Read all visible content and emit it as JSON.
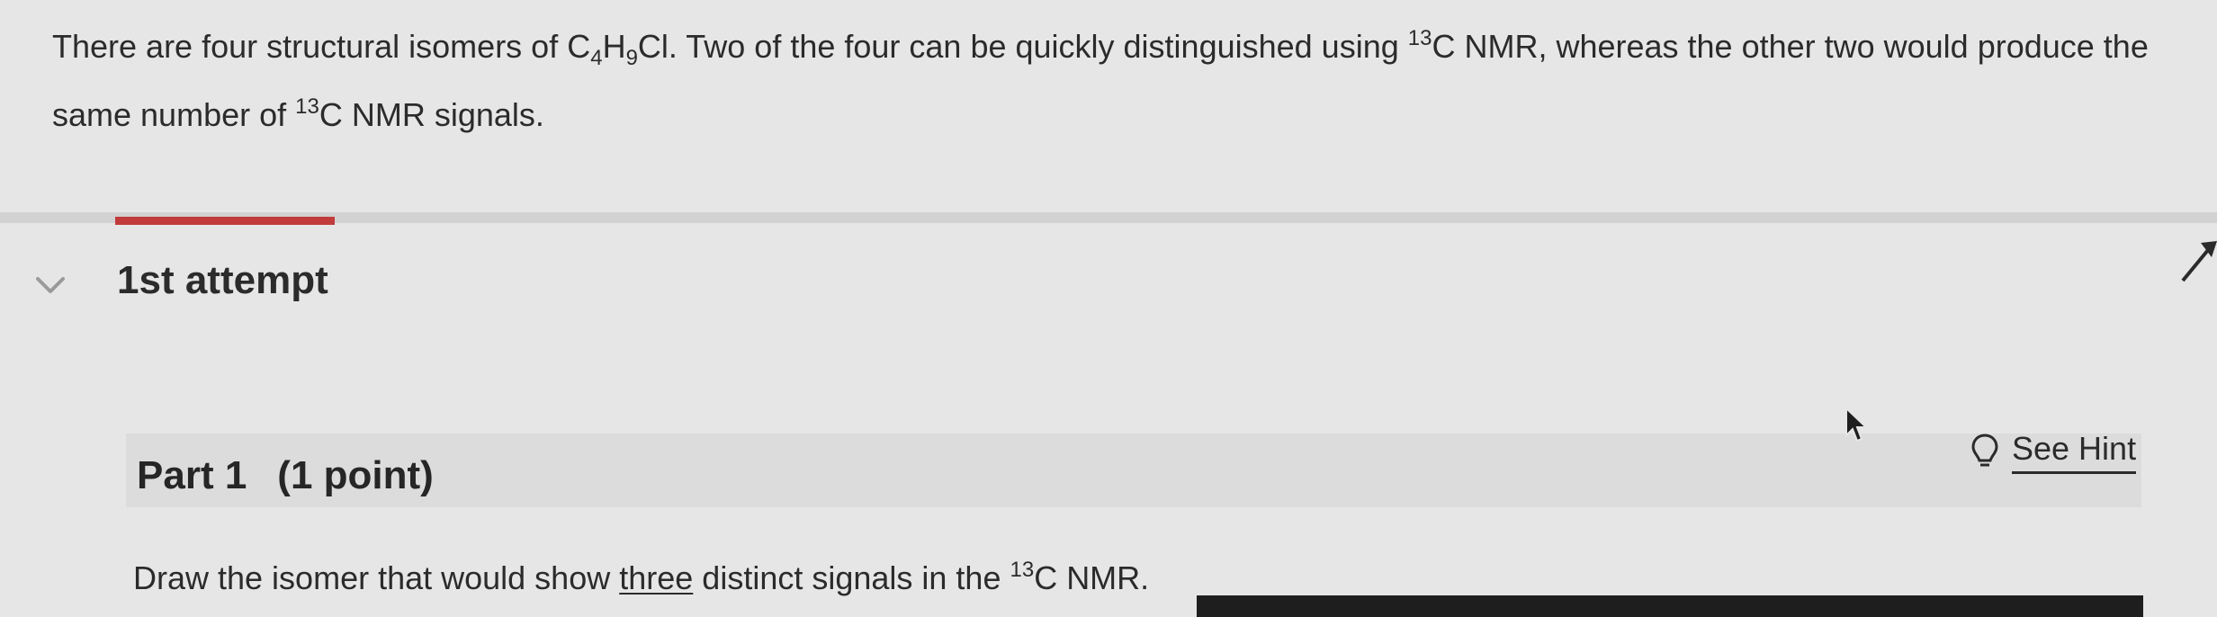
{
  "question": {
    "t1": "There are four structural isomers of C",
    "sub1": "4",
    "t2": "H",
    "sub2": "9",
    "t3": "Cl. Two of the four can be quickly distinguished using ",
    "sup1": "13",
    "t4": "C NMR, whereas the other two would produce the same number of ",
    "sup2": "13",
    "t5": "C NMR signals."
  },
  "attempt": {
    "label": "1st attempt"
  },
  "part": {
    "title": "Part 1",
    "points": "(1 point)"
  },
  "hint": {
    "label": "See Hint",
    "icon": "lightbulb-icon"
  },
  "prompt": {
    "t1": "Draw the isomer that would show ",
    "emphasis": "three",
    "t2": " distinct signals in the ",
    "sup": "13",
    "t3": "C NMR."
  },
  "colors": {
    "background": "#e6e6e6",
    "progress": "#c23b3b",
    "text": "#2b2b2b"
  }
}
